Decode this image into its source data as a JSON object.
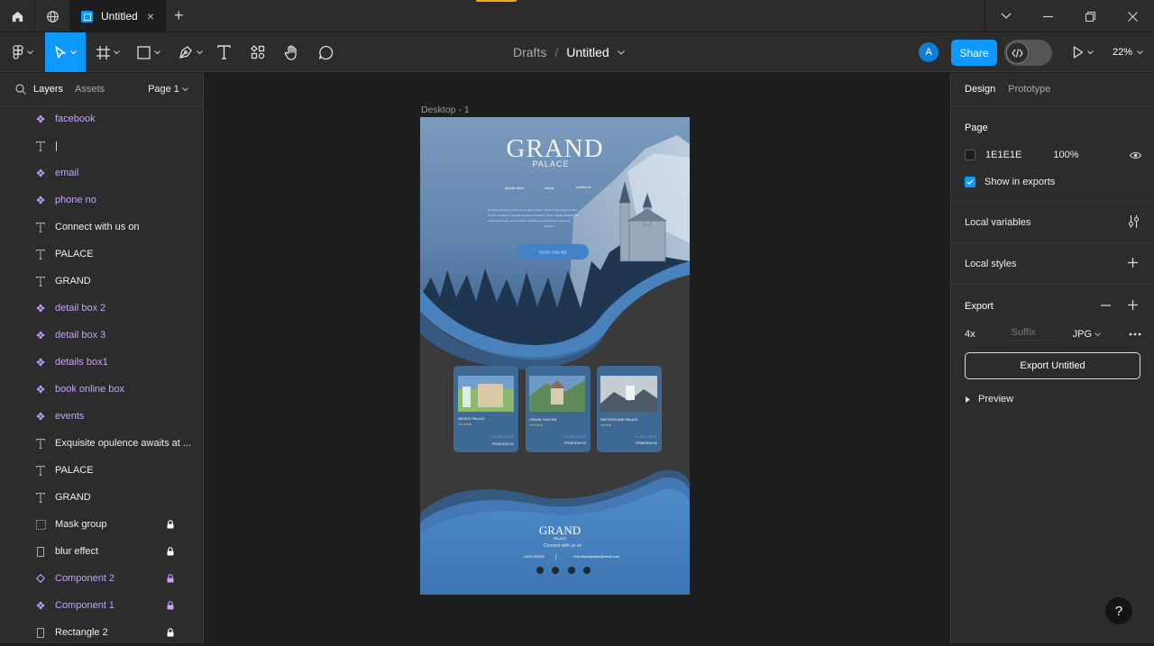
{
  "titlebar": {
    "tab_label": "Untitled",
    "tab_close": "×",
    "new_tab": "+"
  },
  "toolbar": {
    "breadcrumb_drafts": "Drafts",
    "breadcrumb_sep": "/",
    "file_name": "Untitled",
    "avatar_initial": "A",
    "share_label": "Share",
    "zoom_label": "22%"
  },
  "left_panel": {
    "tab_layers": "Layers",
    "tab_assets": "Assets",
    "page_selector": "Page 1",
    "layers": [
      {
        "label": "facebook",
        "type": "component",
        "locked": false
      },
      {
        "label": "|",
        "type": "text",
        "locked": false
      },
      {
        "label": "email",
        "type": "component",
        "locked": false
      },
      {
        "label": "phone no",
        "type": "component",
        "locked": false
      },
      {
        "label": "Connect with us on",
        "type": "text",
        "locked": false
      },
      {
        "label": "PALACE",
        "type": "text",
        "locked": false
      },
      {
        "label": "GRAND",
        "type": "text",
        "locked": false
      },
      {
        "label": "detail box 2",
        "type": "component",
        "locked": false
      },
      {
        "label": "detail box  3",
        "type": "component",
        "locked": false
      },
      {
        "label": "details box1",
        "type": "component",
        "locked": false
      },
      {
        "label": "book online box",
        "type": "component",
        "locked": false
      },
      {
        "label": "events",
        "type": "component",
        "locked": false
      },
      {
        "label": "Exquisite opulence awaits at ...",
        "type": "text",
        "locked": false
      },
      {
        "label": "PALACE",
        "type": "text",
        "locked": false
      },
      {
        "label": "GRAND",
        "type": "text",
        "locked": false
      },
      {
        "label": "Mask group",
        "type": "mask",
        "locked": true
      },
      {
        "label": "blur effect",
        "type": "rect",
        "locked": true
      },
      {
        "label": "Component 2",
        "type": "main-component",
        "locked": true
      },
      {
        "label": "Component 1",
        "type": "component",
        "locked": true
      },
      {
        "label": "Rectangle 2",
        "type": "rect",
        "locked": true
      }
    ]
  },
  "canvas": {
    "frame_label": "Desktop - 1",
    "hero": {
      "title": "GRAND",
      "subtitle": "PALACE",
      "nav": [
        "special offers",
        "events",
        "contact us"
      ],
      "tagline_lines": [
        "Exquisite opulence awaits at our grand palace, where luxury meets modern",
        "comfort. Indulge in sumptuous accommodations, savor culinary delights from",
        "world-class chefs, and unwind in captivating, meticulously manicured",
        "gardens."
      ],
      "book_button": "BOOK ONLINE"
    },
    "cards": [
      {
        "name": "MEXICO PALACE",
        "stars": "★★★★★",
        "tag": "ALL INCLUSIVE",
        "price": "FROM $700.00"
      },
      {
        "name": "GRAND CANYON",
        "stars": "★★★★★",
        "tag": "ALL INCLUSIVE",
        "price": "FROM $700.00"
      },
      {
        "name": "SWITZERLAND PALACE",
        "stars": "★★★★",
        "tag": "ALL INCLUSIVE",
        "price": "FROM $700.00"
      }
    ],
    "footer": {
      "title": "GRAND",
      "subtitle": "PALACE",
      "connect": "Connect with us on",
      "phone": "1-800-123456",
      "separator": "|",
      "email": "Grandhotelpalace@email.com"
    }
  },
  "right_panel": {
    "tab_design": "Design",
    "tab_prototype": "Prototype",
    "page_title": "Page",
    "page_color": "1E1E1E",
    "page_opacity": "100%",
    "show_in_exports": "Show in exports",
    "local_variables": "Local variables",
    "local_styles": "Local styles",
    "export_title": "Export",
    "export_scale": "4x",
    "export_suffix_placeholder": "Suffix",
    "export_format": "JPG",
    "export_button": "Export Untitled",
    "preview": "Preview"
  },
  "help_label": "?",
  "colors": {
    "accent": "#0d99ff",
    "component_purple": "#c7a0ff",
    "panel_bg": "#2c2c2c",
    "canvas_bg": "#1e1e1e",
    "site_blue": "#3f78b5"
  }
}
